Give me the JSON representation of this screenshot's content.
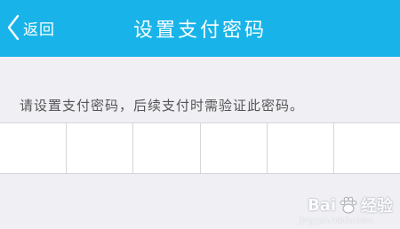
{
  "header": {
    "back_label": "返回",
    "title": "设置支付密码",
    "background": "#18b4e9"
  },
  "hint": "请设置支付密码，后续支付时需验证此密码。",
  "pin": {
    "boxes": [
      "",
      "",
      "",
      "",
      "",
      ""
    ]
  },
  "watermark": {
    "text_left": "Bai",
    "text_right": "经验",
    "sub": "jingyan.baidu.com",
    "icon": "paw-icon"
  }
}
